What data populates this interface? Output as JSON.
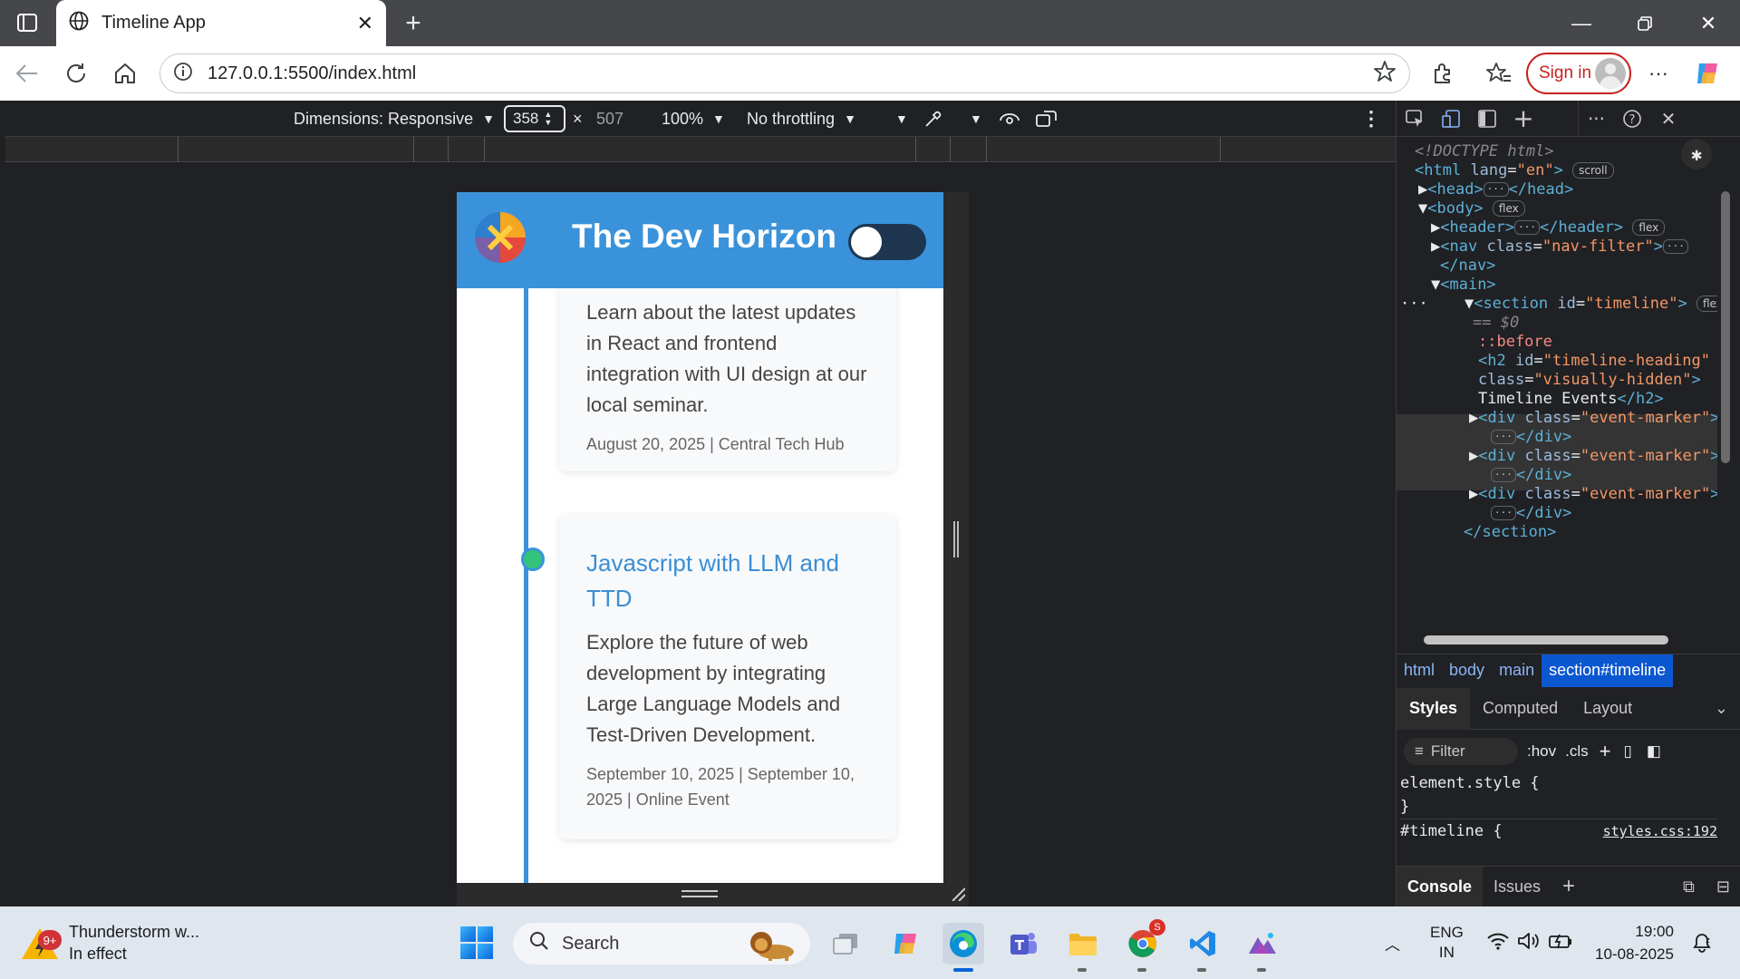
{
  "browser": {
    "tab_title": "Timeline App",
    "url": "127.0.0.1:5500/index.html",
    "sign_in_label": "Sign in"
  },
  "device_toolbar": {
    "dimensions_label": "Dimensions: Responsive",
    "width": "358",
    "times": "×",
    "height": "507",
    "zoom": "100%",
    "throttling": "No throttling"
  },
  "app": {
    "title": "The Dev Horizon",
    "toggle_on": false,
    "colors": {
      "header": "#3a93da",
      "accent": "#3a8ed4",
      "dot": "#34c37a"
    },
    "events": [
      {
        "title": "",
        "description": "Learn about the latest updates in React and frontend integration with UI design at our local seminar.",
        "meta": "August 20, 2025 | Central Tech Hub"
      },
      {
        "title": "Javascript with LLM and TTD",
        "description": "Explore the future of web development by integrating Large Language Models and Test-Driven Development.",
        "meta": "September 10, 2025 | September 10, 2025 | Online Event"
      }
    ]
  },
  "devtools": {
    "dom": {
      "doctype": "<!DOCTYPE html>",
      "html_open": "<html",
      "lang_attr": "lang",
      "lang_val": "\"en\"",
      "scroll_badge": "scroll",
      "head": "<head>",
      "head_close": "</head>",
      "body": "<body>",
      "flex_badge": "flex",
      "header": "<header>",
      "header_close": "</header>",
      "nav_open": "<nav",
      "class_attr": "class",
      "nav_class": "\"nav-filter\"",
      "nav_close": "</nav>",
      "main": "<main>",
      "section_open": "<section",
      "id_attr": "id",
      "section_id": "\"timeline\"",
      "dollar0": "== $0",
      "before": "::before",
      "h2_open": "<h2",
      "h2_id": "\"timeline-heading\"",
      "h2_class": "\"visually-hidden\"",
      "h2_text": "Timeline Events",
      "h2_close": "</h2>",
      "div_open": "<div",
      "div_class": "\"event-marker\"",
      "div_close": "</div>",
      "section_close": "</section>"
    },
    "breadcrumbs": [
      "html",
      "body",
      "main",
      "section#timeline"
    ],
    "styles_tabs": [
      "Styles",
      "Computed",
      "Layout"
    ],
    "filter_placeholder": "Filter",
    "hov": ":hov",
    "cls": ".cls",
    "rule1_selector": "element.style {",
    "rule1_close": "}",
    "rule2_selector": "#timeline {",
    "rule2_source": "styles.css:192",
    "drawer_tabs": [
      "Console",
      "Issues"
    ]
  },
  "taskbar": {
    "weather_title": "Thunderstorm w...",
    "weather_sub": "In effect",
    "weather_badge": "9+",
    "search_label": "Search",
    "lang_1": "ENG",
    "lang_2": "IN",
    "time": "19:00",
    "date": "10-08-2025"
  }
}
